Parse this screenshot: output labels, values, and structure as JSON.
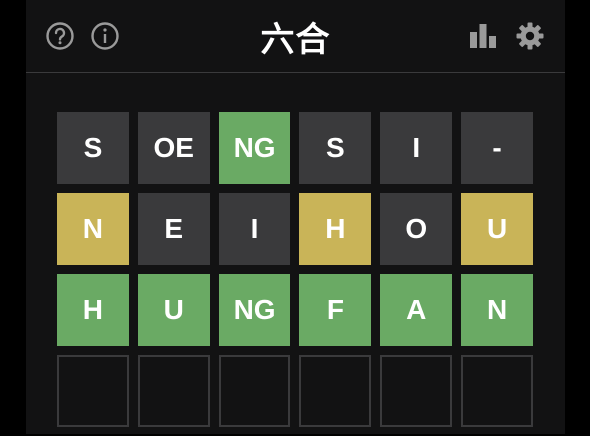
{
  "header": {
    "title": "六合",
    "icons": [
      "help-icon",
      "info-icon",
      "stats-icon",
      "settings-icon"
    ]
  },
  "colors": {
    "background": "#121213",
    "absent": "#3a3a3c",
    "present": "#c9b458",
    "correct": "#6aaa64",
    "empty_border": "#3a3a3c"
  },
  "board": {
    "rows": [
      [
        {
          "letter": "S",
          "state": "absent"
        },
        {
          "letter": "OE",
          "state": "absent"
        },
        {
          "letter": "NG",
          "state": "correct"
        },
        {
          "letter": "S",
          "state": "absent"
        },
        {
          "letter": "I",
          "state": "absent"
        },
        {
          "letter": "-",
          "state": "absent"
        }
      ],
      [
        {
          "letter": "N",
          "state": "present"
        },
        {
          "letter": "E",
          "state": "absent"
        },
        {
          "letter": "I",
          "state": "absent"
        },
        {
          "letter": "H",
          "state": "present"
        },
        {
          "letter": "O",
          "state": "absent"
        },
        {
          "letter": "U",
          "state": "present"
        }
      ],
      [
        {
          "letter": "H",
          "state": "correct"
        },
        {
          "letter": "U",
          "state": "correct"
        },
        {
          "letter": "NG",
          "state": "correct"
        },
        {
          "letter": "F",
          "state": "correct"
        },
        {
          "letter": "A",
          "state": "correct"
        },
        {
          "letter": "N",
          "state": "correct"
        }
      ],
      [
        {
          "letter": "",
          "state": "empty"
        },
        {
          "letter": "",
          "state": "empty"
        },
        {
          "letter": "",
          "state": "empty"
        },
        {
          "letter": "",
          "state": "empty"
        },
        {
          "letter": "",
          "state": "empty"
        },
        {
          "letter": "",
          "state": "empty"
        }
      ]
    ]
  }
}
